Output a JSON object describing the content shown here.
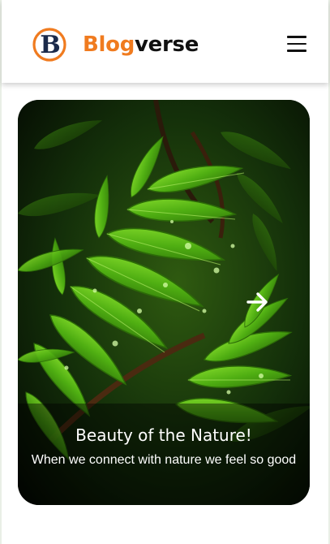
{
  "header": {
    "brand_part1": "Blog",
    "brand_part2": "verse",
    "logo_letter": "B",
    "menu_icon": "hamburger-menu-icon"
  },
  "slide": {
    "title": "Beauty of the Nature!",
    "text": "When we connect with nature we feel so good",
    "next_icon": "arrow-right-icon",
    "image": "green-fern-leaves-with-water-droplets"
  },
  "colors": {
    "brand_orange": "#f07b1f",
    "brand_navy": "#1b2a4a",
    "text_dark": "#111111",
    "leaf_green": "#5fc21a"
  }
}
